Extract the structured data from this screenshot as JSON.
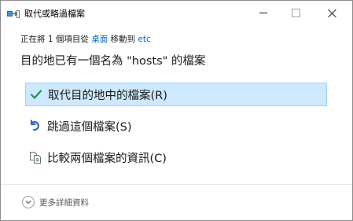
{
  "window": {
    "title": "取代或略過檔案"
  },
  "progress": {
    "prefix": "正在將 1 個項目從 ",
    "source": "桌面",
    "middle": " 移動到 ",
    "destination": "etc"
  },
  "headline": "目的地已有一個名為 \"hosts\" 的檔案",
  "options": [
    {
      "label": "取代目的地中的檔案(R)",
      "icon": "checkmark-icon",
      "selected": true
    },
    {
      "label": "跳過這個檔案(S)",
      "icon": "skip-arrow-icon",
      "selected": false
    },
    {
      "label": "比較兩個檔案的資訊(C)",
      "icon": "compare-files-icon",
      "selected": false
    }
  ],
  "footer": {
    "more_details": "更多詳細資料",
    "icon": "chevron-down-icon"
  },
  "colors": {
    "selection_bg": "#cde8ff",
    "selection_border": "#99d1ff",
    "link": "#0066cc",
    "check": "#2e8b57"
  }
}
